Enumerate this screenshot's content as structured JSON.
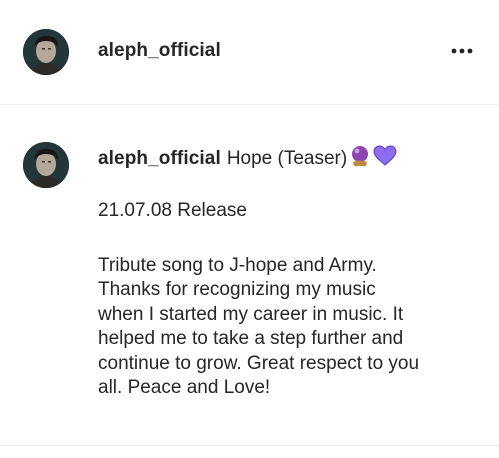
{
  "post": {
    "username": "aleph_official",
    "more_icon": "ellipsis-horizontal-icon"
  },
  "caption": {
    "username": "aleph_official",
    "title": "Hope (Teaser)",
    "emojis": [
      "crystal-ball-icon",
      "purple-heart-icon"
    ],
    "release": "21.07.08 Release",
    "body_lines": [
      "Tribute song to J-hope and Army.",
      "Thanks for recognizing my music",
      "when I started my career in music. It",
      "helped me to take a step further and",
      "continue to grow. Great respect to you",
      "all. Peace and Love!"
    ]
  },
  "colors": {
    "text": "#262626",
    "divider": "#efefef",
    "purple_heart": "#8e6cef",
    "crystal_ball": "#9b59b6"
  }
}
